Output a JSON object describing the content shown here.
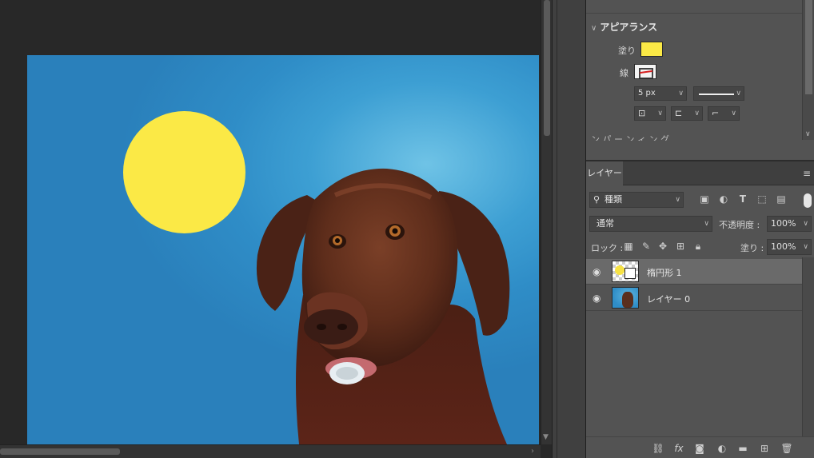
{
  "canvas": {
    "colors": {
      "background": "#2f8dc7",
      "ellipse": "#fbe946"
    }
  },
  "properties": {
    "section_title": "アピアランス",
    "fill_label": "塗り",
    "stroke_label": "線",
    "stroke_width": "5 px",
    "next_section_partial": "ン パ ー ン ィ ン グ",
    "icons": [
      "chevron-down-icon",
      "align-stroke-icon",
      "line-cap-icon",
      "line-join-icon"
    ]
  },
  "layers": {
    "tab_label": "レイヤー",
    "filter_kind": "種類",
    "blend_mode": "通常",
    "opacity_label": "不透明度 :",
    "opacity_value": "100%",
    "lock_label": "ロック :",
    "fill_label": "塗り :",
    "fill_value": "100%",
    "items": [
      {
        "name": "楕円形 1",
        "selected": true,
        "visible": true,
        "thumb": "shape"
      },
      {
        "name": "レイヤー 0",
        "selected": false,
        "visible": true,
        "thumb": "photo"
      }
    ],
    "filter_icons": [
      "image-filter-icon",
      "adjustment-filter-icon",
      "type-filter-icon",
      "shape-filter-icon",
      "smart-object-filter-icon"
    ],
    "lock_icons": [
      "lock-transparency-icon",
      "lock-pixels-icon",
      "lock-position-icon",
      "lock-artboard-icon",
      "lock-all-icon"
    ],
    "footer_icons": [
      "link-icon",
      "fx-icon",
      "mask-icon",
      "adjustment-icon",
      "folder-icon",
      "new-layer-icon",
      "trash-icon"
    ]
  }
}
